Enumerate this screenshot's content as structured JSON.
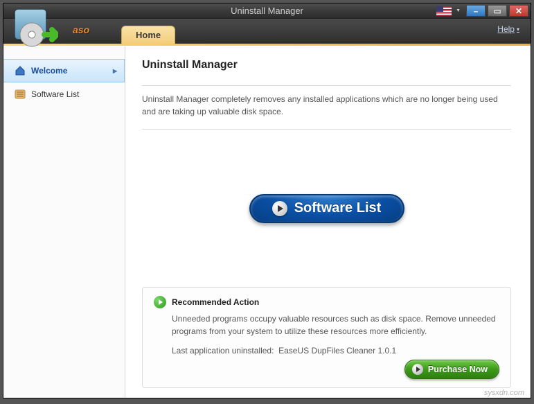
{
  "window": {
    "title": "Uninstall Manager"
  },
  "brand": "aso",
  "tabs": {
    "home": "Home"
  },
  "help": "Help",
  "sidebar": {
    "items": [
      {
        "label": "Welcome"
      },
      {
        "label": "Software List"
      }
    ]
  },
  "page": {
    "heading": "Uninstall Manager",
    "description": "Uninstall Manager completely removes any installed applications which are no longer being used and are taking up valuable disk space.",
    "cta": "Software List"
  },
  "recommended": {
    "title": "Recommended Action",
    "text": "Unneeded programs occupy valuable resources such as disk space. Remove unneeded programs from your system to utilize these resources more efficiently.",
    "last_label": "Last application uninstalled:",
    "last_value": "EaseUS DupFiles Cleaner 1.0.1"
  },
  "purchase": "Purchase Now",
  "watermark": "sysxdn.com"
}
